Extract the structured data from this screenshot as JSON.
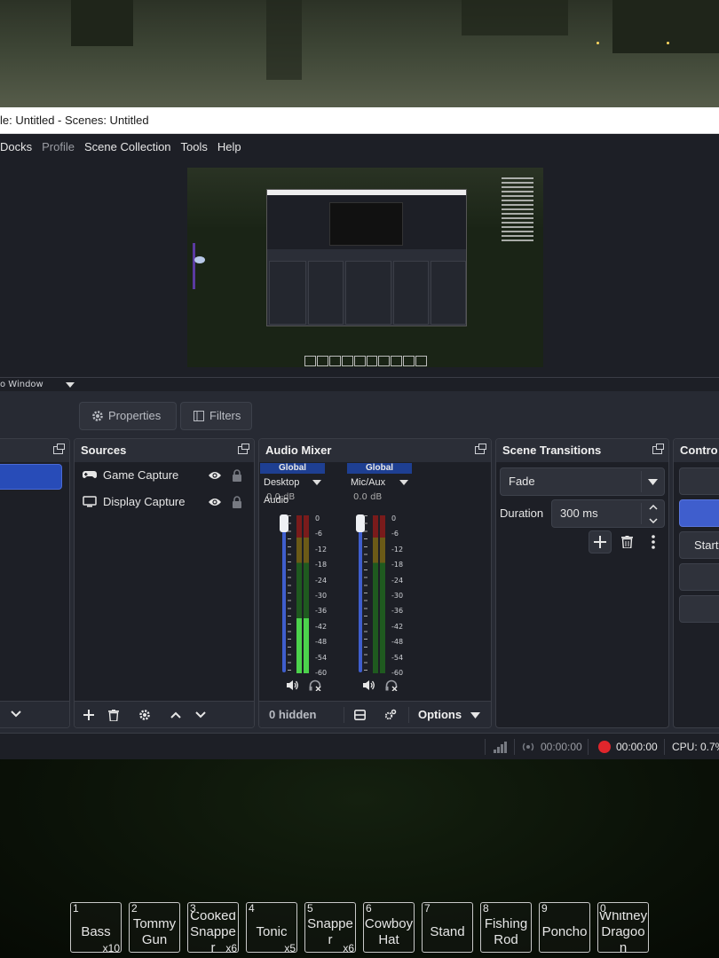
{
  "window": {
    "title": "le: Untitled - Scenes: Untitled"
  },
  "menu": [
    "Docks",
    "Profile",
    "Scene Collection",
    "Tools",
    "Help"
  ],
  "preview_context": {
    "label": "o Window"
  },
  "toolbar": {
    "properties": "Properties",
    "filters": "Filters"
  },
  "sources": {
    "title": "Sources",
    "items": [
      {
        "name": "Game Capture",
        "icon": "gamepad-icon"
      },
      {
        "name": "Display Capture",
        "icon": "monitor-icon"
      }
    ]
  },
  "audio_mixer": {
    "title": "Audio Mixer",
    "channels": [
      {
        "global": "Global",
        "name": "Desktop Audio",
        "db": "0.0 dB",
        "level": 0.35
      },
      {
        "global": "Global",
        "name": "Mic/Aux",
        "db": "0.0 dB",
        "level": 0.0
      }
    ],
    "scale": [
      "0",
      "-6",
      "-12",
      "-18",
      "-24",
      "-30",
      "-36",
      "-42",
      "-48",
      "-54",
      "-60"
    ],
    "hidden": "0 hidden",
    "options": "Options"
  },
  "transitions": {
    "title": "Scene Transitions",
    "selected": "Fade",
    "duration_label": "Duration",
    "duration_value": "300 ms"
  },
  "controls": {
    "title": "Contro",
    "start_partial": "Start"
  },
  "status": {
    "stream_time": "00:00:00",
    "record_time": "00:00:00",
    "cpu": "CPU: 0.7%"
  },
  "hotbar": [
    {
      "num": "1",
      "name": "Bass",
      "qty": "x10"
    },
    {
      "num": "2",
      "name": "Tommy Gun",
      "qty": ""
    },
    {
      "num": "3",
      "name": "Cooked Snapper",
      "qty": "x6"
    },
    {
      "num": "4",
      "name": "Tonic",
      "qty": "x5"
    },
    {
      "num": "5",
      "name": "Snapper",
      "qty": "x6"
    },
    {
      "num": "6",
      "name": "Cowboy Hat",
      "qty": ""
    },
    {
      "num": "7",
      "name": "Stand",
      "qty": ""
    },
    {
      "num": "8",
      "name": "FishingRod",
      "qty": ""
    },
    {
      "num": "9",
      "name": "Poncho",
      "qty": ""
    },
    {
      "num": "0",
      "name": "Whitney Dragoon",
      "qty": ""
    }
  ],
  "colors": {
    "accent": "#284cb8",
    "global_header": "#1e3f92",
    "record": "#e0262c",
    "bg": "#1d1f26"
  }
}
